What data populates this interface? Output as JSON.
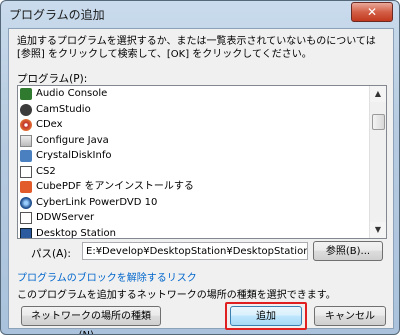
{
  "window": {
    "title": "プログラムの追加",
    "close_label": "✕"
  },
  "description": "追加するプログラムを選択するか、または一覧表示されていないものについては [参照] をクリックして検索して、[OK] をクリックしてください。",
  "programs_label": "プログラム(P):",
  "programs": [
    {
      "label": "Audio Console",
      "icon": "audio-console-icon"
    },
    {
      "label": "CamStudio",
      "icon": "camstudio-icon"
    },
    {
      "label": "CDex",
      "icon": "cdex-icon"
    },
    {
      "label": "Configure Java",
      "icon": "java-icon"
    },
    {
      "label": "CrystalDiskInfo",
      "icon": "crystaldiskinfo-icon"
    },
    {
      "label": "CS2",
      "icon": "app-icon"
    },
    {
      "label": "CubePDF をアンインストールする",
      "icon": "cubepdf-icon"
    },
    {
      "label": "CyberLink PowerDVD 10",
      "icon": "powerdvd-icon"
    },
    {
      "label": "DDWServer",
      "icon": "app-icon"
    },
    {
      "label": "Desktop Station",
      "icon": "desktop-station-icon"
    },
    {
      "label": "",
      "icon": "app-icon"
    }
  ],
  "selected_program": "Desktop Station",
  "path_label": "パス(A):",
  "path_value": "E:¥Develop¥DesktopStation¥DesktopStation¥bin¥F",
  "browse_label": "参照(B)...",
  "unblock_link": "プログラムのブロックを解除するリスク",
  "network_text": "このプログラムを追加するネットワークの場所の種類を選択できます。",
  "network_type_label": "ネットワークの場所の種類(N)...",
  "add_label": "追加",
  "cancel_label": "キャンセル",
  "highlight_color": "#e02020"
}
